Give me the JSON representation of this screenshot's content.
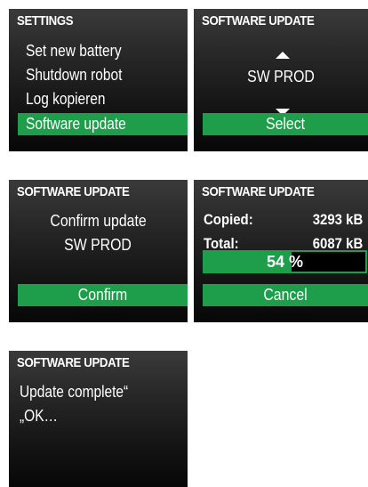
{
  "panels": {
    "settings": {
      "title": "SETTINGS",
      "items": [
        "Set new battery",
        "Shutdown robot",
        "Log kopieren",
        "Software update"
      ],
      "selected_index": 3
    },
    "select": {
      "title": "SOFTWARE UPDATE",
      "option": "SW PROD",
      "button": "Select"
    },
    "confirm": {
      "title": "SOFTWARE UPDATE",
      "line1": "Confirm update",
      "line2": "SW PROD",
      "button": "Confirm"
    },
    "progress": {
      "title": "SOFTWARE UPDATE",
      "copied_label": "Copied:",
      "copied_value": "3293 kB",
      "total_label": "Total:",
      "total_value": "6087 kB",
      "percent": 54,
      "percent_text": "54 %",
      "button": "Cancel"
    },
    "complete": {
      "title": "SOFTWARE UPDATE",
      "line1": "Update complete“",
      "line2": "„OK…"
    }
  },
  "colors": {
    "accent": "#1e9e4a",
    "panel_top": "#3a3a3a",
    "panel_bottom": "#070707",
    "text": "#ffffff"
  },
  "icons": [
    "arrow-up-icon",
    "arrow-down-icon"
  ]
}
